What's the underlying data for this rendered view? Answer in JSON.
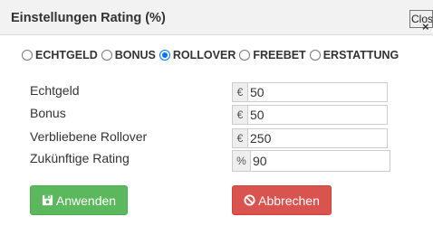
{
  "dialog": {
    "title": "Einstellungen Rating (%)",
    "close_label": "Close",
    "close_glyph": "×"
  },
  "bonus_types": {
    "options": [
      "ECHTGELD",
      "BONUS",
      "ROLLOVER",
      "FREEBET",
      "ERSTATTUNG"
    ],
    "selected": "ROLLOVER"
  },
  "fields": [
    {
      "label": "Echtgeld",
      "unit": "€",
      "value": "50"
    },
    {
      "label": "Bonus",
      "unit": "€",
      "value": "50"
    },
    {
      "label": "Verbliebene Rollover",
      "unit": "€",
      "value": "250"
    },
    {
      "label": "Zukünftige Rating",
      "unit": "%",
      "value": "90"
    }
  ],
  "buttons": {
    "apply_label": "Anwenden",
    "apply_icon": "save-icon",
    "apply_color": "#5cb85c",
    "cancel_label": "Abbrechen",
    "cancel_icon": "ban-icon",
    "cancel_color": "#d9534f"
  }
}
